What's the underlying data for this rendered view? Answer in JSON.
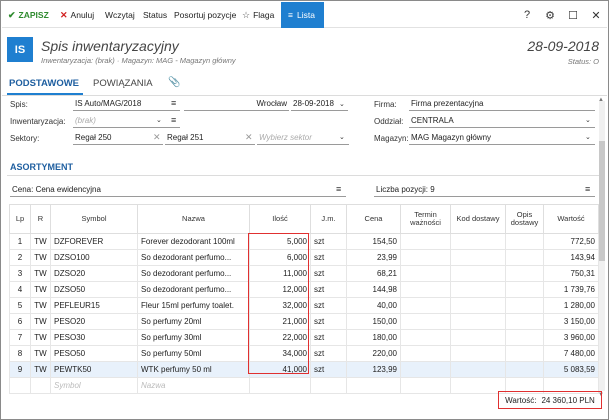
{
  "toolbar": {
    "save": "ZAPISZ",
    "cancel": "Anuluj",
    "load": "Wczytaj",
    "status": "Status",
    "sort": "Posortuj pozycje",
    "flag": "Flaga",
    "list": "Lista",
    "help": "?",
    "settings": "⚙",
    "maximize": "☐",
    "close": "✕"
  },
  "header": {
    "badge": "IS",
    "title": "Spis inwentaryzacyjny",
    "subtitle": "Inwentaryzacja: (brak)  ·  Magazyn: MAG - Magazyn główny",
    "date": "28-09-2018",
    "status": "Status: O"
  },
  "tabs": {
    "basic": "PODSTAWOWE",
    "links": "POWIĄZANIA",
    "attachments": "📎"
  },
  "form": {
    "spis_label": "Spis:",
    "spis_value": "IS Auto/MAG/2018",
    "place": "Wrocław",
    "date": "28-09-2018",
    "inwentaryzacja_label": "Inwentaryzacja:",
    "inwentaryzacja_placeholder": "(brak)",
    "sektory_label": "Sektory:",
    "sector1": "Regał 250",
    "sector2": "Regał 251",
    "sector_placeholder": "Wybierz sektor",
    "firma_label": "Firma:",
    "firma_value": "Firma prezentacyjna",
    "oddzial_label": "Oddział:",
    "oddzial_value": "CENTRALA",
    "magazyn_label": "Magazyn:",
    "magazyn_value": "MAG  Magazyn główny"
  },
  "section": {
    "title": "ASORTYMENT",
    "price_type": "Cena: Cena ewidencyjna",
    "count": "Liczba pozycji: 9"
  },
  "table": {
    "columns": [
      "Lp",
      "R",
      "Symbol",
      "Nazwa",
      "Ilość",
      "J.m.",
      "Cena",
      "Termin ważności",
      "Kod dostawy",
      "Opis dostawy",
      "Wartość"
    ],
    "rows": [
      {
        "lp": "1",
        "r": "TW",
        "symbol": "DZFOREVER",
        "nazwa": "Forever dezodorant 100ml",
        "ilosc": "5,000",
        "jm": "szt",
        "cena": "154,50",
        "termin": "",
        "kod": "",
        "opis": "",
        "wartosc": "772,50"
      },
      {
        "lp": "2",
        "r": "TW",
        "symbol": "DZSO100",
        "nazwa": "So dezodorant perfumo...",
        "ilosc": "6,000",
        "jm": "szt",
        "cena": "23,99",
        "termin": "",
        "kod": "",
        "opis": "",
        "wartosc": "143,94"
      },
      {
        "lp": "3",
        "r": "TW",
        "symbol": "DZSO20",
        "nazwa": "So dezodorant perfumo...",
        "ilosc": "11,000",
        "jm": "szt",
        "cena": "68,21",
        "termin": "",
        "kod": "",
        "opis": "",
        "wartosc": "750,31"
      },
      {
        "lp": "4",
        "r": "TW",
        "symbol": "DZSO50",
        "nazwa": "So dezodorant perfumo...",
        "ilosc": "12,000",
        "jm": "szt",
        "cena": "144,98",
        "termin": "",
        "kod": "",
        "opis": "",
        "wartosc": "1 739,76"
      },
      {
        "lp": "5",
        "r": "TW",
        "symbol": "PEFLEUR15",
        "nazwa": "Fleur 15ml perfumy toalet.",
        "ilosc": "32,000",
        "jm": "szt",
        "cena": "40,00",
        "termin": "",
        "kod": "",
        "opis": "",
        "wartosc": "1 280,00"
      },
      {
        "lp": "6",
        "r": "TW",
        "symbol": "PESO20",
        "nazwa": "So perfumy 20ml",
        "ilosc": "21,000",
        "jm": "szt",
        "cena": "150,00",
        "termin": "",
        "kod": "",
        "opis": "",
        "wartosc": "3 150,00"
      },
      {
        "lp": "7",
        "r": "TW",
        "symbol": "PESO30",
        "nazwa": "So perfumy 30ml",
        "ilosc": "22,000",
        "jm": "szt",
        "cena": "180,00",
        "termin": "",
        "kod": "",
        "opis": "",
        "wartosc": "3 960,00"
      },
      {
        "lp": "8",
        "r": "TW",
        "symbol": "PESO50",
        "nazwa": "So perfumy 50ml",
        "ilosc": "34,000",
        "jm": "szt",
        "cena": "220,00",
        "termin": "",
        "kod": "",
        "opis": "",
        "wartosc": "7 480,00"
      },
      {
        "lp": "9",
        "r": "TW",
        "symbol": "PEWTK50",
        "nazwa": "WTK perfumy 50 ml",
        "ilosc": "41,000",
        "jm": "szt",
        "cena": "123,99",
        "termin": "",
        "kod": "",
        "opis": "",
        "wartosc": "5 083,59"
      }
    ],
    "new_row": {
      "symbol": "Symbol",
      "nazwa": "Nazwa"
    }
  },
  "footer": {
    "total_label": "Wartość:",
    "total_value": "24 360,10 PLN"
  },
  "colors": {
    "accent": "#1f7fd0",
    "save": "#2e8b2e",
    "cancel": "#d12020",
    "highlight": "#e03030"
  }
}
